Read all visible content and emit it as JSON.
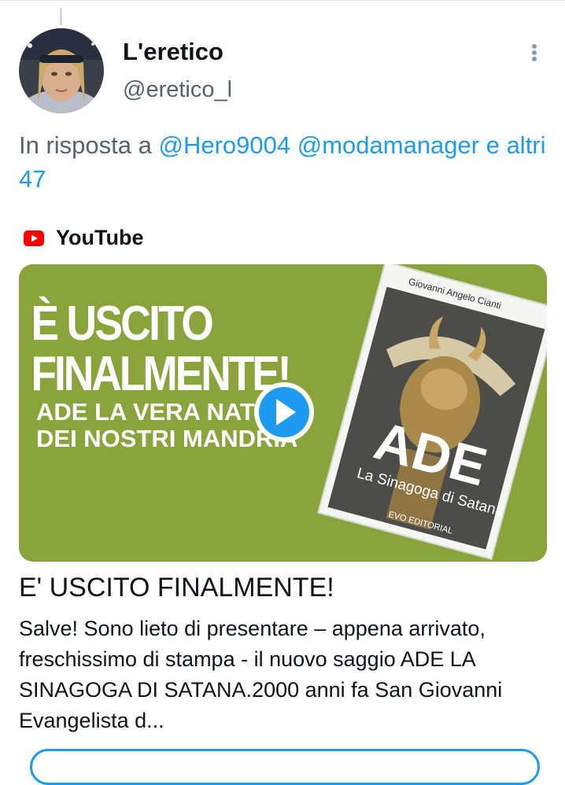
{
  "tweet": {
    "display_name": "L'eretico",
    "handle": "@eretico_l",
    "reply_prefix": "In risposta a",
    "reply_mentions": "@Hero9004 @modamanager e altri 47"
  },
  "card": {
    "source": "YouTube",
    "thumbnail": {
      "line1": "È USCITO",
      "line2": "FINALMENTE!",
      "line3": "ADE LA VERA NATU",
      "line4": "DEI NOSTRI MANDRIA",
      "book_author": "Giovanni Angelo Cianti",
      "book_title": "ADE",
      "book_subtitle": "La Sinagoga di Satana",
      "book_publisher": "EVO EDITORIAL"
    },
    "title": "E' USCITO FINALMENTE!",
    "description": "Salve! Sono lieto di presentare – appena arrivato, freschissimo di stampa - il nuovo saggio ADE LA SINAGOGA DI SATANA.2000 anni fa San Giovanni Evangelista d..."
  },
  "colors": {
    "link": "#1d9bf0",
    "thumbnail_bg": "#8aa43c",
    "youtube_red": "#ff0000"
  },
  "icons": [
    "more-options-icon",
    "youtube-icon",
    "play-icon"
  ]
}
